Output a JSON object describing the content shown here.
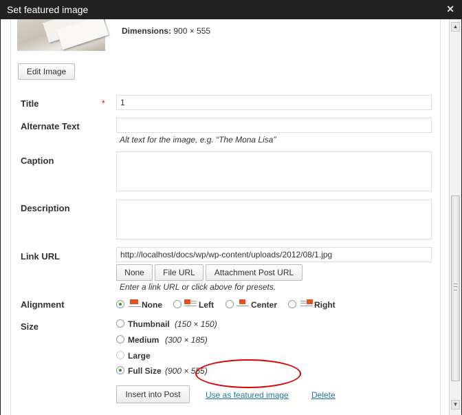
{
  "window": {
    "title": "Set featured image",
    "close_icon": "close-icon"
  },
  "image": {
    "dimensions_label": "Dimensions:",
    "dimensions_value": "900 × 555",
    "edit_button": "Edit Image"
  },
  "fields": {
    "title": {
      "label": "Title",
      "required_mark": "*",
      "value": "1"
    },
    "alt_text": {
      "label": "Alternate Text",
      "value": "",
      "hint": "Alt text for the image, e.g. “The Mona Lisa”"
    },
    "caption": {
      "label": "Caption",
      "value": ""
    },
    "description": {
      "label": "Description",
      "value": ""
    },
    "link_url": {
      "label": "Link URL",
      "value": "http://localhost/docs/wp/wp-content/uploads/2012/08/1.jpg",
      "buttons": [
        "None",
        "File URL",
        "Attachment Post URL"
      ],
      "hint": "Enter a link URL or click above for presets."
    },
    "alignment": {
      "label": "Alignment",
      "options": [
        "None",
        "Left",
        "Center",
        "Right"
      ],
      "selected": "None"
    },
    "size": {
      "label": "Size",
      "options": [
        {
          "label": "Thumbnail",
          "dims": "(150 × 150)"
        },
        {
          "label": "Medium",
          "dims": "(300 × 185)"
        },
        {
          "label": "Large",
          "dims": ""
        },
        {
          "label": "Full Size",
          "dims": "(900 × 555)"
        }
      ],
      "selected": "Full Size",
      "disabled": [
        "Large"
      ]
    }
  },
  "actions": {
    "insert": "Insert into Post",
    "featured": "Use as featured image",
    "delete": "Delete"
  },
  "colors": {
    "accent_link": "#21759b",
    "highlight_ellipse": "#dd0000",
    "radio_checked": "#2a9a2a",
    "titlebar": "#222222"
  }
}
